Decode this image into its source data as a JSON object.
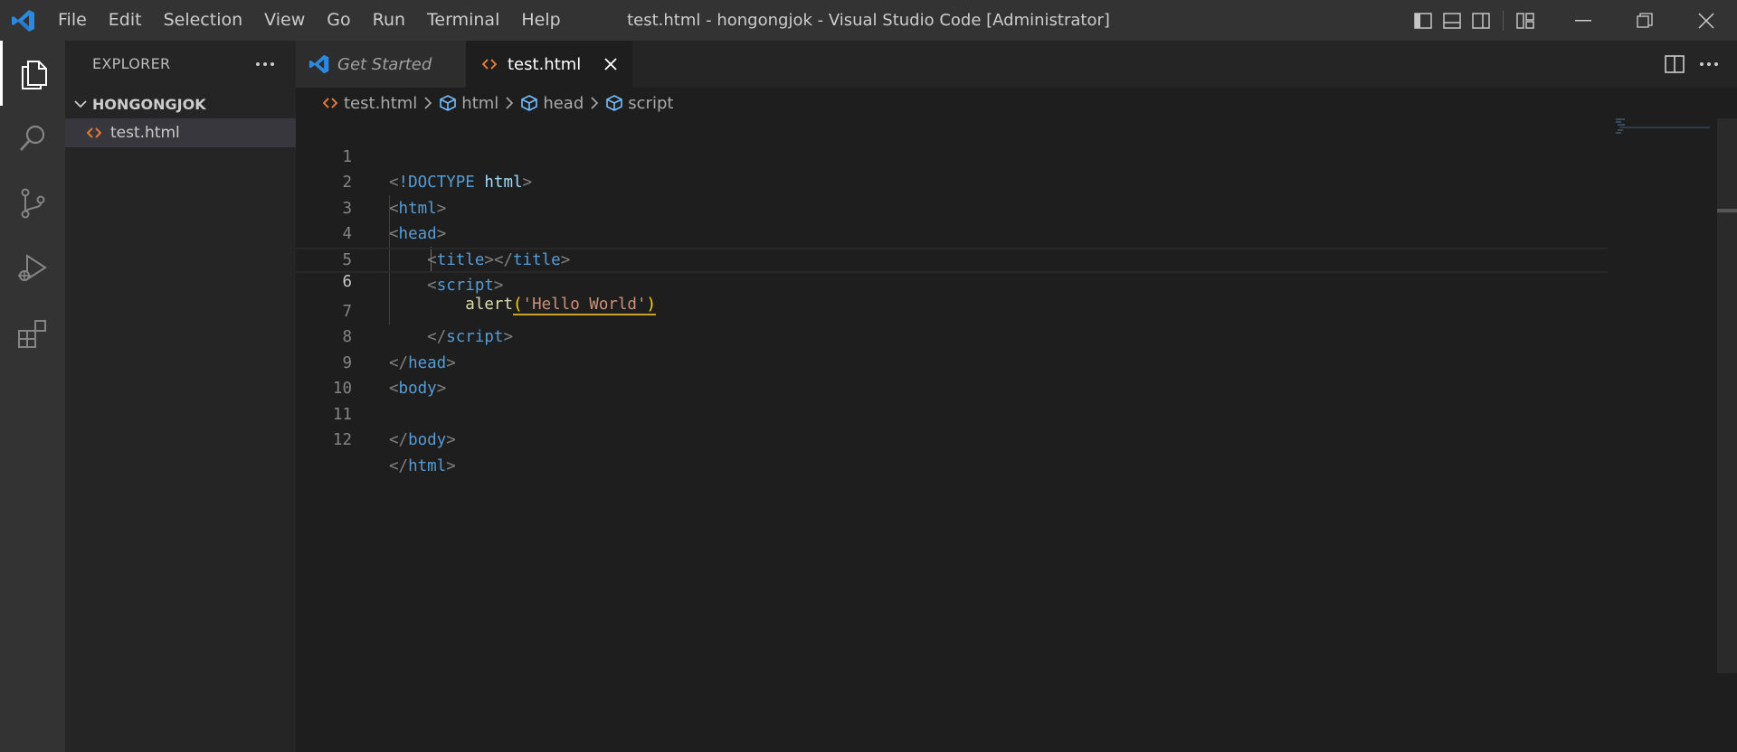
{
  "window": {
    "title": "test.html - hongongjok - Visual Studio Code [Administrator]"
  },
  "menu": [
    "File",
    "Edit",
    "Selection",
    "View",
    "Go",
    "Run",
    "Terminal",
    "Help"
  ],
  "activity_bar": {
    "items": [
      "explorer-icon",
      "search-icon",
      "source-control-icon",
      "run-debug-icon",
      "extensions-icon"
    ],
    "active": "explorer-icon"
  },
  "sidebar": {
    "header": "EXPLORER",
    "folder": "HONGONGJOK",
    "files": [
      {
        "name": "test.html",
        "selected": true
      }
    ]
  },
  "tabs": [
    {
      "label": "Get Started",
      "active": false
    },
    {
      "label": "test.html",
      "active": true
    }
  ],
  "breadcrumb": [
    "test.html",
    "html",
    "head",
    "script"
  ],
  "editor": {
    "current_line": 6,
    "lines": [
      {
        "n": "1"
      },
      {
        "n": "2"
      },
      {
        "n": "3"
      },
      {
        "n": "4"
      },
      {
        "n": "5"
      },
      {
        "n": "6"
      },
      {
        "n": "7"
      },
      {
        "n": "8"
      },
      {
        "n": "9"
      },
      {
        "n": "10"
      },
      {
        "n": "11"
      },
      {
        "n": "12"
      }
    ],
    "tokens": {
      "lt": "<",
      "gt": ">",
      "lt_slash": "</",
      "doctype": "!DOCTYPE",
      "doctype_name": "html",
      "html": "html",
      "head": "head",
      "title": "title",
      "script": "script",
      "body": "body",
      "fn": "alert",
      "paren_open": "(",
      "paren_close": ")",
      "str": "'Hello World'"
    }
  },
  "colors": {
    "accent": "#0078d4",
    "html_icon": "#e37933",
    "tag": "#569cd6",
    "string": "#ce9178",
    "function": "#dcdcaa"
  }
}
